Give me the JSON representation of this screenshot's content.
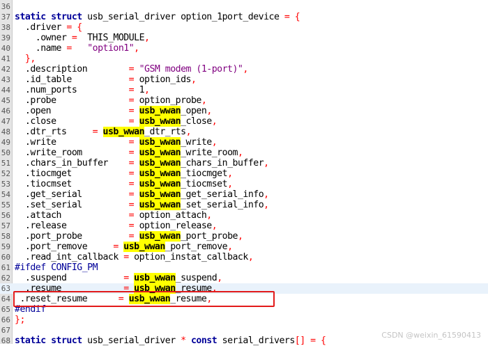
{
  "watermark": "CSDN @weixin_61590413",
  "lines": [
    {
      "n": "36",
      "segs": []
    },
    {
      "n": "37",
      "segs": [
        {
          "t": "static struct",
          "c": "kw"
        },
        {
          "t": " usb_serial_driver option_1port_device "
        },
        {
          "t": "= {",
          "c": "op"
        }
      ]
    },
    {
      "n": "38",
      "segs": [
        {
          "t": "  .driver "
        },
        {
          "t": "= {",
          "c": "op"
        }
      ]
    },
    {
      "n": "39",
      "segs": [
        {
          "t": "    .owner "
        },
        {
          "t": "=",
          "c": "op"
        },
        {
          "t": "  THIS_MODULE"
        },
        {
          "t": ",",
          "c": "op"
        }
      ]
    },
    {
      "n": "40",
      "segs": [
        {
          "t": "    .name "
        },
        {
          "t": "=",
          "c": "op"
        },
        {
          "t": "   "
        },
        {
          "t": "\"option1\"",
          "c": "str"
        },
        {
          "t": ",",
          "c": "op"
        }
      ]
    },
    {
      "n": "41",
      "segs": [
        {
          "t": "  },",
          "c": "op"
        }
      ]
    },
    {
      "n": "42",
      "segs": [
        {
          "t": "  .description        "
        },
        {
          "t": "=",
          "c": "op"
        },
        {
          "t": " "
        },
        {
          "t": "\"GSM modem (1-port)\"",
          "c": "str"
        },
        {
          "t": ",",
          "c": "op"
        }
      ]
    },
    {
      "n": "43",
      "segs": [
        {
          "t": "  .id_table           "
        },
        {
          "t": "=",
          "c": "op"
        },
        {
          "t": " option_ids"
        },
        {
          "t": ",",
          "c": "op"
        }
      ]
    },
    {
      "n": "44",
      "segs": [
        {
          "t": "  .num_ports          "
        },
        {
          "t": "=",
          "c": "op"
        },
        {
          "t": " 1"
        },
        {
          "t": ",",
          "c": "op"
        }
      ]
    },
    {
      "n": "45",
      "segs": [
        {
          "t": "  .probe              "
        },
        {
          "t": "=",
          "c": "op"
        },
        {
          "t": " option_probe"
        },
        {
          "t": ",",
          "c": "op"
        }
      ]
    },
    {
      "n": "46",
      "segs": [
        {
          "t": "  .open               "
        },
        {
          "t": "=",
          "c": "op"
        },
        {
          "t": " "
        },
        {
          "t": "usb_wwan",
          "c": "mark"
        },
        {
          "t": "_open"
        },
        {
          "t": ",",
          "c": "op"
        }
      ]
    },
    {
      "n": "47",
      "segs": [
        {
          "t": "  .close              "
        },
        {
          "t": "=",
          "c": "op"
        },
        {
          "t": " "
        },
        {
          "t": "usb_wwan",
          "c": "mark"
        },
        {
          "t": "_close"
        },
        {
          "t": ",",
          "c": "op"
        }
      ]
    },
    {
      "n": "48",
      "segs": [
        {
          "t": "  .dtr_rts     "
        },
        {
          "t": "=",
          "c": "op"
        },
        {
          "t": " "
        },
        {
          "t": "usb_wwan",
          "c": "mark"
        },
        {
          "t": "_dtr_rts"
        },
        {
          "t": ",",
          "c": "op"
        }
      ]
    },
    {
      "n": "49",
      "segs": [
        {
          "t": "  .write              "
        },
        {
          "t": "=",
          "c": "op"
        },
        {
          "t": " "
        },
        {
          "t": "usb_wwan",
          "c": "mark"
        },
        {
          "t": "_write"
        },
        {
          "t": ",",
          "c": "op"
        }
      ]
    },
    {
      "n": "50",
      "segs": [
        {
          "t": "  .write_room         "
        },
        {
          "t": "=",
          "c": "op"
        },
        {
          "t": " "
        },
        {
          "t": "usb_wwan",
          "c": "mark"
        },
        {
          "t": "_write_room"
        },
        {
          "t": ",",
          "c": "op"
        }
      ]
    },
    {
      "n": "51",
      "segs": [
        {
          "t": "  .chars_in_buffer    "
        },
        {
          "t": "=",
          "c": "op"
        },
        {
          "t": " "
        },
        {
          "t": "usb_wwan",
          "c": "mark"
        },
        {
          "t": "_chars_in_buffer"
        },
        {
          "t": ",",
          "c": "op"
        }
      ]
    },
    {
      "n": "52",
      "segs": [
        {
          "t": "  .tiocmget           "
        },
        {
          "t": "=",
          "c": "op"
        },
        {
          "t": " "
        },
        {
          "t": "usb_wwan",
          "c": "mark"
        },
        {
          "t": "_tiocmget"
        },
        {
          "t": ",",
          "c": "op"
        }
      ]
    },
    {
      "n": "53",
      "segs": [
        {
          "t": "  .tiocmset           "
        },
        {
          "t": "=",
          "c": "op"
        },
        {
          "t": " "
        },
        {
          "t": "usb_wwan",
          "c": "mark"
        },
        {
          "t": "_tiocmset"
        },
        {
          "t": ",",
          "c": "op"
        }
      ]
    },
    {
      "n": "54",
      "segs": [
        {
          "t": "  .get_serial         "
        },
        {
          "t": "=",
          "c": "op"
        },
        {
          "t": " "
        },
        {
          "t": "usb_wwan",
          "c": "mark"
        },
        {
          "t": "_get_serial_info"
        },
        {
          "t": ",",
          "c": "op"
        }
      ]
    },
    {
      "n": "55",
      "segs": [
        {
          "t": "  .set_serial         "
        },
        {
          "t": "=",
          "c": "op"
        },
        {
          "t": " "
        },
        {
          "t": "usb_wwan",
          "c": "mark"
        },
        {
          "t": "_set_serial_info"
        },
        {
          "t": ",",
          "c": "op"
        }
      ]
    },
    {
      "n": "56",
      "segs": [
        {
          "t": "  .attach             "
        },
        {
          "t": "=",
          "c": "op"
        },
        {
          "t": " option_attach"
        },
        {
          "t": ",",
          "c": "op"
        }
      ]
    },
    {
      "n": "57",
      "segs": [
        {
          "t": "  .release            "
        },
        {
          "t": "=",
          "c": "op"
        },
        {
          "t": " option_release"
        },
        {
          "t": ",",
          "c": "op"
        }
      ]
    },
    {
      "n": "58",
      "segs": [
        {
          "t": "  .port_probe         "
        },
        {
          "t": "=",
          "c": "op"
        },
        {
          "t": " "
        },
        {
          "t": "usb_wwan",
          "c": "mark"
        },
        {
          "t": "_port_probe"
        },
        {
          "t": ",",
          "c": "op"
        }
      ]
    },
    {
      "n": "59",
      "segs": [
        {
          "t": "  .port_remove     "
        },
        {
          "t": "=",
          "c": "op"
        },
        {
          "t": " "
        },
        {
          "t": "usb_wwan",
          "c": "mark"
        },
        {
          "t": "_port_remove"
        },
        {
          "t": ",",
          "c": "op"
        }
      ]
    },
    {
      "n": "60",
      "segs": [
        {
          "t": "  .read_int_callback "
        },
        {
          "t": "=",
          "c": "op"
        },
        {
          "t": " option_instat_callback"
        },
        {
          "t": ",",
          "c": "op"
        }
      ]
    },
    {
      "n": "61",
      "segs": [
        {
          "t": "#ifdef CONFIG_PM",
          "c": "pp"
        }
      ]
    },
    {
      "n": "62",
      "segs": [
        {
          "t": "  .suspend           "
        },
        {
          "t": "=",
          "c": "op"
        },
        {
          "t": " "
        },
        {
          "t": "usb_wwan",
          "c": "mark"
        },
        {
          "t": "_suspend"
        },
        {
          "t": ",",
          "c": "op"
        }
      ]
    },
    {
      "n": "63",
      "hl": true,
      "segs": [
        {
          "t": "  .resume            "
        },
        {
          "t": "=",
          "c": "op"
        },
        {
          "t": " "
        },
        {
          "t": "usb_wwan",
          "c": "mark"
        },
        {
          "t": "_resume"
        },
        {
          "t": ",",
          "c": "op"
        }
      ]
    },
    {
      "n": "64",
      "segs": [
        {
          "t": " .reset_resume      "
        },
        {
          "t": "=",
          "c": "op"
        },
        {
          "t": " "
        },
        {
          "t": "usb_wwan",
          "c": "mark"
        },
        {
          "t": "_resume"
        },
        {
          "t": ",",
          "c": "op"
        }
      ]
    },
    {
      "n": "65",
      "segs": [
        {
          "t": "#endif",
          "c": "pp"
        }
      ]
    },
    {
      "n": "66",
      "segs": [
        {
          "t": "};",
          "c": "op"
        }
      ]
    },
    {
      "n": "67",
      "segs": []
    },
    {
      "n": "68",
      "segs": [
        {
          "t": "static struct",
          "c": "kw"
        },
        {
          "t": " usb_serial_driver "
        },
        {
          "t": "*",
          "c": "op"
        },
        {
          "t": " "
        },
        {
          "t": "const",
          "c": "kw"
        },
        {
          "t": " serial_drivers"
        },
        {
          "t": "[] = {",
          "c": "op"
        }
      ]
    }
  ]
}
